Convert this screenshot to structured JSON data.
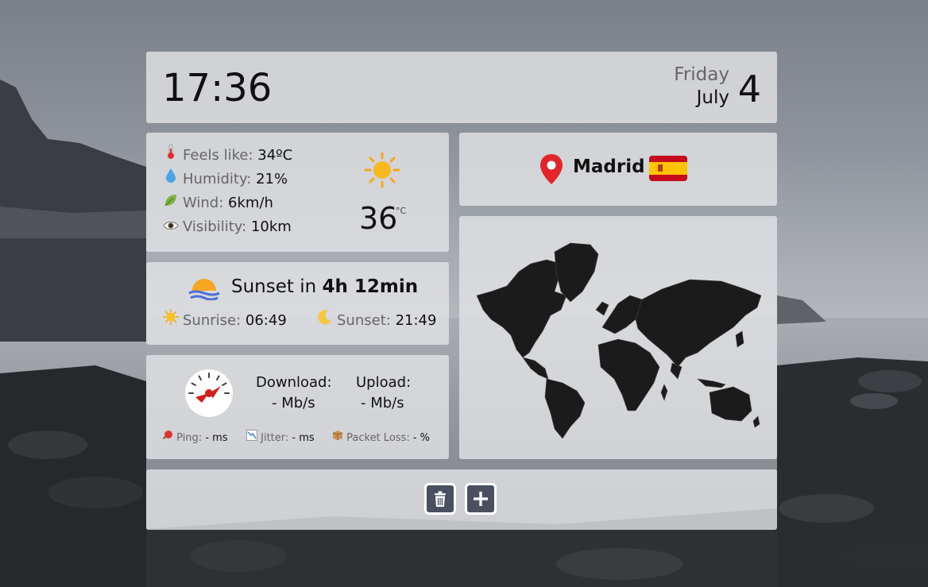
{
  "clock": {
    "time": "17:36",
    "weekday": "Friday",
    "month": "July",
    "day": "4"
  },
  "weather": {
    "feels_like_label": "Feels like:",
    "feels_like_value": "34ºC",
    "humidity_label": "Humidity:",
    "humidity_value": "21%",
    "wind_label": "Wind:",
    "wind_value": "6km/h",
    "visibility_label": "Visibility:",
    "visibility_value": "10km",
    "temperature": "36",
    "unit": "°C",
    "icons": [
      "thermometer-icon",
      "droplet-icon",
      "leaf-icon",
      "eye-icon",
      "sun-icon"
    ]
  },
  "location": {
    "city": "Madrid",
    "flag": "Spain",
    "accent": "#e0262b"
  },
  "sun": {
    "headline_prefix": "Sunset in",
    "headline_value": "4h 12min",
    "sunrise_label": "Sunrise:",
    "sunrise_time": "06:49",
    "sunset_label": "Sunset:",
    "sunset_time": "21:49"
  },
  "speed": {
    "download_label": "Download:",
    "download_value": "- Mb/s",
    "upload_label": "Upload:",
    "upload_value": "- Mb/s",
    "ping_label": "Ping:",
    "ping_value": "- ms",
    "jitter_label": "Jitter:",
    "jitter_value": "- ms",
    "loss_label": "Packet Loss:",
    "loss_value": "- %"
  },
  "toolbar": {
    "buttons": [
      "trash-icon",
      "plus-icon"
    ],
    "button_color": "#4a5060"
  }
}
